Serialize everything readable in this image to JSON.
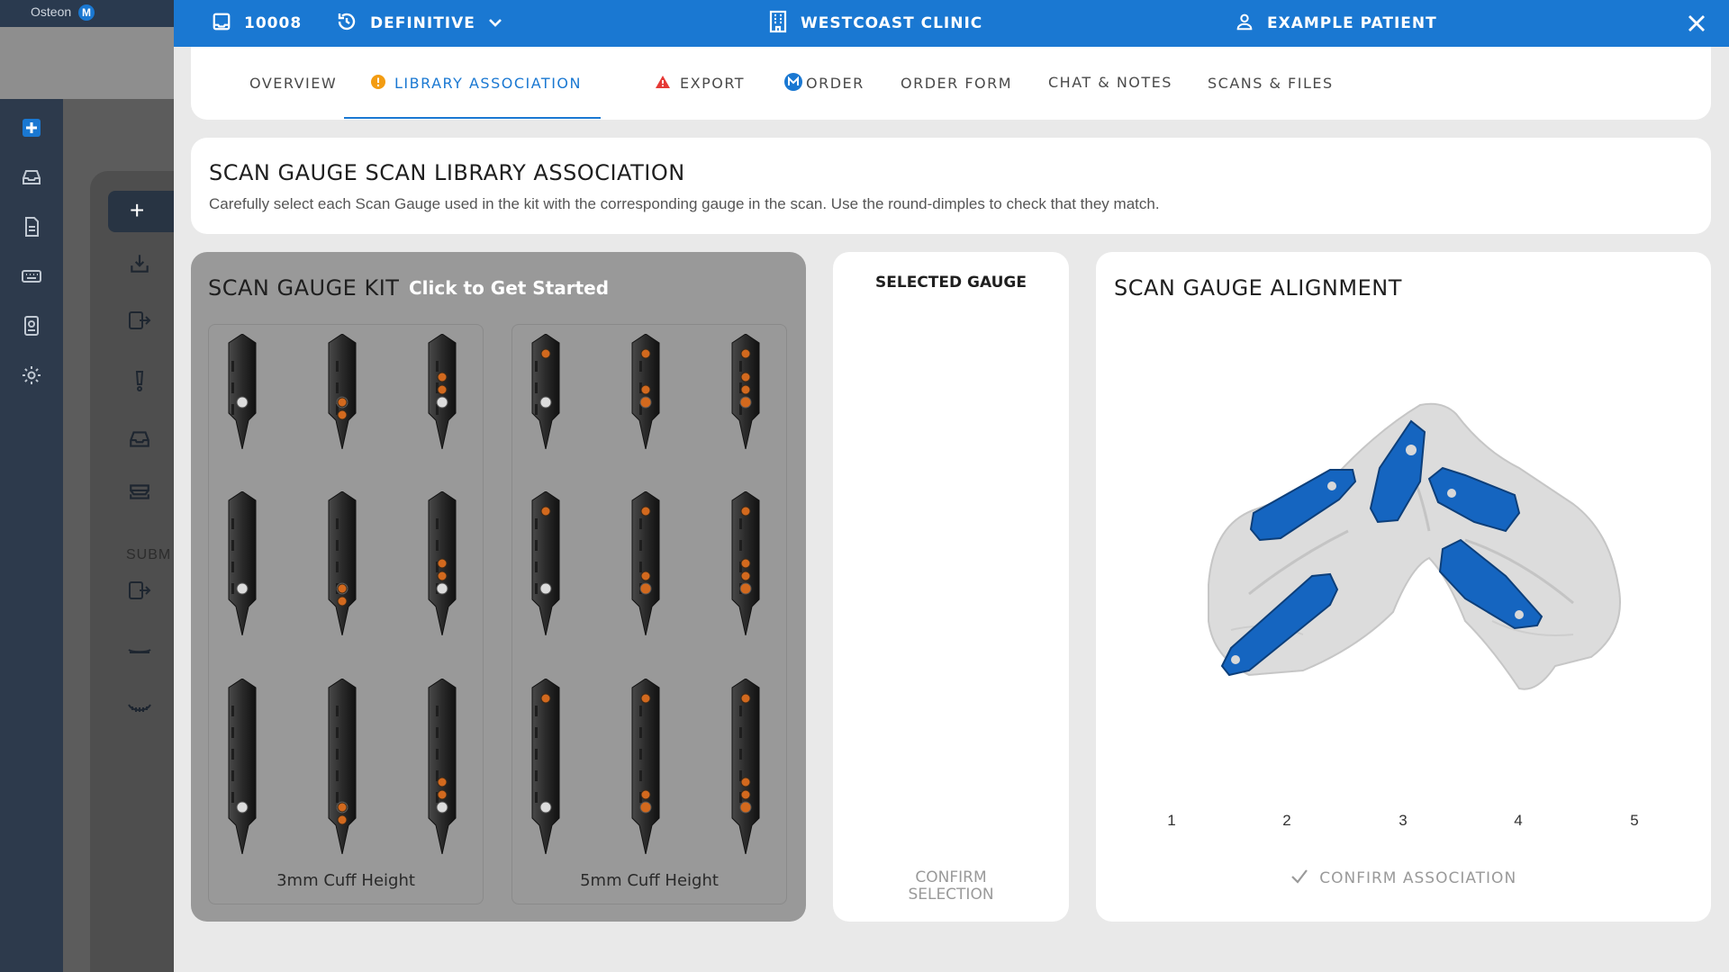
{
  "background_app": {
    "logo_text": "Osteon",
    "logo_badge": "M",
    "submit_label": "SUBM"
  },
  "header": {
    "case_id": "10008",
    "status": "DEFINITIVE",
    "clinic": "WESTCOAST CLINIC",
    "patient": "EXAMPLE PATIENT"
  },
  "tabs": [
    {
      "label": "OVERVIEW",
      "active": false
    },
    {
      "label": "LIBRARY ASSOCIATION",
      "active": true,
      "badge": "warning-circle-icon"
    },
    {
      "label": "EXPORT",
      "active": false,
      "badge": "warning-triangle-icon"
    },
    {
      "label": "ORDER",
      "active": false,
      "badge": "osteon-logo-icon"
    },
    {
      "label": "ORDER FORM",
      "active": false
    },
    {
      "label": "CHAT & NOTES",
      "active": false
    },
    {
      "label": "SCANS & FILES",
      "active": false
    }
  ],
  "intro": {
    "title": "SCAN GAUGE SCAN LIBRARY ASSOCIATION",
    "description": "Carefully select each Scan Gauge used in the kit with the corresponding gauge in the scan. Use the round-dimples to check that they match."
  },
  "kit": {
    "title": "SCAN GAUGE KIT",
    "overlay": "Click to Get Started",
    "groups": [
      {
        "label": "3mm Cuff Height"
      },
      {
        "label": "5mm Cuff Height"
      }
    ]
  },
  "selected": {
    "title": "SELECTED GAUGE",
    "confirm_label": "CONFIRM\nSELECTION"
  },
  "alignment": {
    "title": "SCAN GAUGE ALIGNMENT",
    "positions": [
      "1",
      "2",
      "3",
      "4",
      "5"
    ],
    "confirm_label": "CONFIRM ASSOCIATION"
  },
  "colors": {
    "header_blue": "#1a78d2",
    "gauge_blue": "#1565c0",
    "dimple_orange": "#d2691e",
    "warning_orange": "#f39c12",
    "warning_red": "#e53935"
  }
}
